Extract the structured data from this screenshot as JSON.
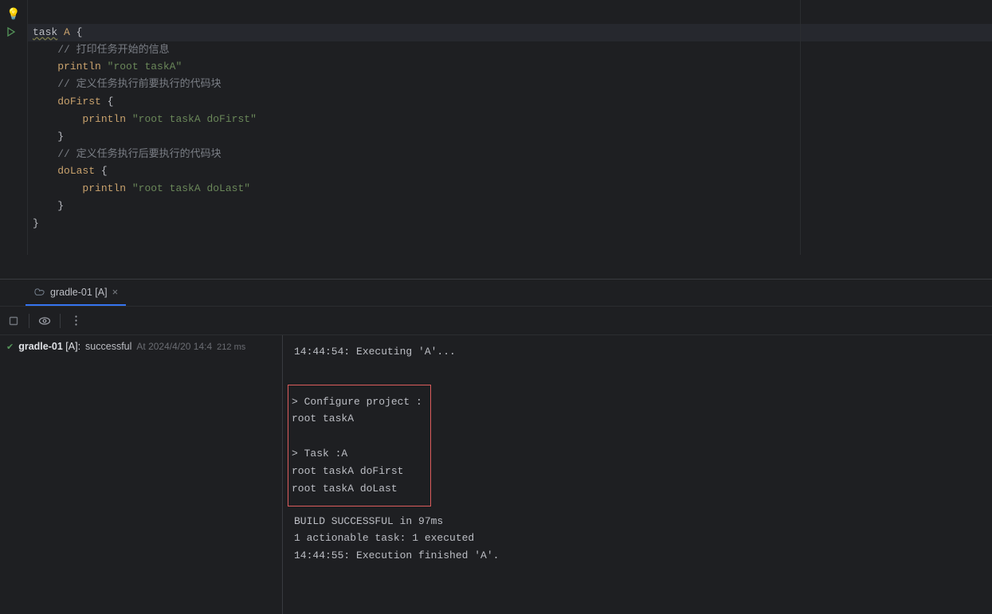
{
  "code": {
    "lines": [
      {
        "hl": false,
        "tokens": []
      },
      {
        "hl": true,
        "tokens": [
          {
            "t": "task",
            "c": "tok-default kw-underline"
          },
          {
            "t": " ",
            "c": ""
          },
          {
            "t": "A",
            "c": "tok-id"
          },
          {
            "t": " ",
            "c": ""
          },
          {
            "t": "{",
            "c": "tok-brace"
          }
        ]
      },
      {
        "hl": false,
        "tokens": [
          {
            "t": "    ",
            "c": ""
          },
          {
            "t": "// 打印任务开始的信息",
            "c": "tok-comment"
          }
        ]
      },
      {
        "hl": false,
        "tokens": [
          {
            "t": "    ",
            "c": ""
          },
          {
            "t": "println",
            "c": "tok-id"
          },
          {
            "t": " ",
            "c": ""
          },
          {
            "t": "\"root taskA\"",
            "c": "tok-string"
          }
        ]
      },
      {
        "hl": false,
        "tokens": [
          {
            "t": "    ",
            "c": ""
          },
          {
            "t": "// 定义任务执行前要执行的代码块",
            "c": "tok-comment"
          }
        ]
      },
      {
        "hl": false,
        "tokens": [
          {
            "t": "    ",
            "c": ""
          },
          {
            "t": "doFirst",
            "c": "tok-id"
          },
          {
            "t": " ",
            "c": ""
          },
          {
            "t": "{",
            "c": "tok-brace"
          }
        ]
      },
      {
        "hl": false,
        "tokens": [
          {
            "t": "        ",
            "c": ""
          },
          {
            "t": "println",
            "c": "tok-id"
          },
          {
            "t": " ",
            "c": ""
          },
          {
            "t": "\"root taskA doFirst\"",
            "c": "tok-string"
          }
        ]
      },
      {
        "hl": false,
        "tokens": [
          {
            "t": "    ",
            "c": ""
          },
          {
            "t": "}",
            "c": "tok-brace"
          }
        ]
      },
      {
        "hl": false,
        "tokens": [
          {
            "t": "    ",
            "c": ""
          },
          {
            "t": "// 定义任务执行后要执行的代码块",
            "c": "tok-comment"
          }
        ]
      },
      {
        "hl": false,
        "tokens": [
          {
            "t": "    ",
            "c": ""
          },
          {
            "t": "doLast",
            "c": "tok-id"
          },
          {
            "t": " ",
            "c": ""
          },
          {
            "t": "{",
            "c": "tok-brace"
          }
        ]
      },
      {
        "hl": false,
        "tokens": [
          {
            "t": "        ",
            "c": ""
          },
          {
            "t": "println",
            "c": "tok-id"
          },
          {
            "t": " ",
            "c": ""
          },
          {
            "t": "\"root taskA doLast\"",
            "c": "tok-string"
          }
        ]
      },
      {
        "hl": false,
        "tokens": [
          {
            "t": "    ",
            "c": ""
          },
          {
            "t": "}",
            "c": "tok-brace"
          }
        ]
      },
      {
        "hl": false,
        "tokens": [
          {
            "t": "}",
            "c": "tok-brace"
          }
        ]
      }
    ]
  },
  "tab": {
    "label": "gradle-01 [A]"
  },
  "tree": {
    "name_bold": "gradle-01",
    "name_rest": " [A]:",
    "status": "successful",
    "time_prefix": "At 2024/4/20 14:4",
    "duration": "212 ms"
  },
  "console": {
    "pre": "14:44:54: Executing 'A'...\n",
    "highlight": "> Configure project :\nroot taskA\n\n> Task :A\nroot taskA doFirst\nroot taskA doLast",
    "post": "\nBUILD SUCCESSFUL in 97ms\n1 actionable task: 1 executed\n14:44:55: Execution finished 'A'."
  }
}
